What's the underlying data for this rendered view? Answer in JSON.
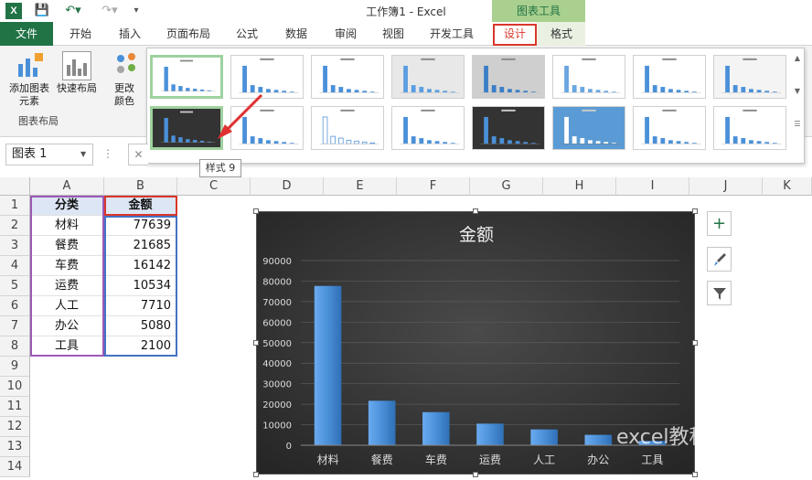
{
  "titlebar": {
    "app_icon": "X",
    "doc_title": "工作簿1 - Excel",
    "chart_tools": "图表工具"
  },
  "tabs": [
    "文件",
    "开始",
    "插入",
    "页面布局",
    "公式",
    "数据",
    "审阅",
    "视图",
    "开发工具",
    "设计",
    "格式"
  ],
  "ribbon": {
    "add_element": "添加图表",
    "add_element2": "元素",
    "quick_layout": "快速布局",
    "change_colors": "更改",
    "change_colors2": "颜色",
    "group_label": "图表布局"
  },
  "gallery": {
    "tooltip": "样式 9"
  },
  "namebox": "图表 1",
  "columns": [
    "A",
    "B",
    "C",
    "D",
    "E",
    "F",
    "G",
    "H",
    "I",
    "J",
    "K"
  ],
  "rows": [
    "1",
    "2",
    "3",
    "4",
    "5",
    "6",
    "7",
    "8",
    "9",
    "10",
    "11",
    "12",
    "13",
    "14"
  ],
  "table": {
    "header": [
      "分类",
      "金额"
    ],
    "rows": [
      [
        "材料",
        "77639"
      ],
      [
        "餐费",
        "21685"
      ],
      [
        "车费",
        "16142"
      ],
      [
        "运费",
        "10534"
      ],
      [
        "人工",
        "7710"
      ],
      [
        "办公",
        "5080"
      ],
      [
        "工具",
        "2100"
      ]
    ]
  },
  "chart_data": {
    "type": "bar",
    "title": "金额",
    "categories": [
      "材料",
      "餐费",
      "车费",
      "运费",
      "人工",
      "办公",
      "工具"
    ],
    "values": [
      77639,
      21685,
      16142,
      10534,
      7710,
      5080,
      2100
    ],
    "ylim": [
      0,
      90000
    ],
    "yticks": [
      "0",
      "10000",
      "20000",
      "30000",
      "40000",
      "50000",
      "60000",
      "70000",
      "80000",
      "90000"
    ],
    "grid": true,
    "bar_color": "#4a90d9",
    "background": "#3a3a3a"
  },
  "watermark": "excel教程"
}
